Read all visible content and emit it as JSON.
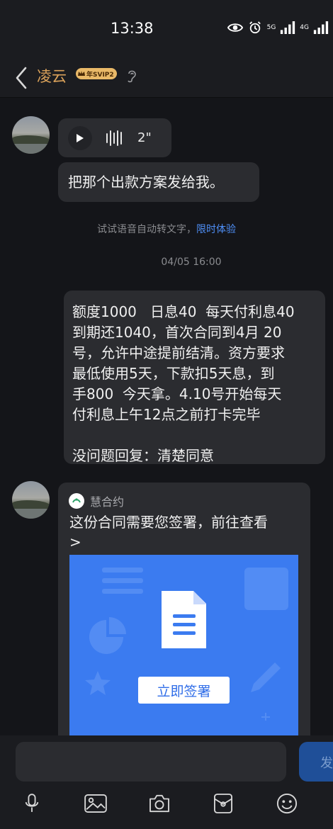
{
  "status_bar": {
    "time": "13:38",
    "network_1": "5G",
    "network_2": "4G"
  },
  "header": {
    "title": "凌云",
    "badge": "年SVIP2"
  },
  "messages": {
    "voice": {
      "duration": "2\""
    },
    "text1": "把那个出款方案发给我。",
    "hint_text": "试试语音自动转文字，",
    "hint_link": "限时体验",
    "timestamp": "04/05 16:00",
    "text2": "额度1000   日息40  每天付利息40\n到期还1040，首次合同到4月 20\n号，允许中途提前结清。资方要求\n最低使用5天，下款扣5天息，到\n手800  今天拿。4.10号开始每天\n付利息上午12点之前打卡完毕\n\n没问题回复：清楚同意",
    "card": {
      "source": "慧合约",
      "text": "这份合同需要您签署，前往查看\n>",
      "button": "立即签署"
    }
  },
  "composer": {
    "send_label": "发"
  },
  "colors": {
    "accent_gold": "#dba25a",
    "link_blue": "#4f8ff7",
    "card_blue": "#3b7bf0"
  }
}
